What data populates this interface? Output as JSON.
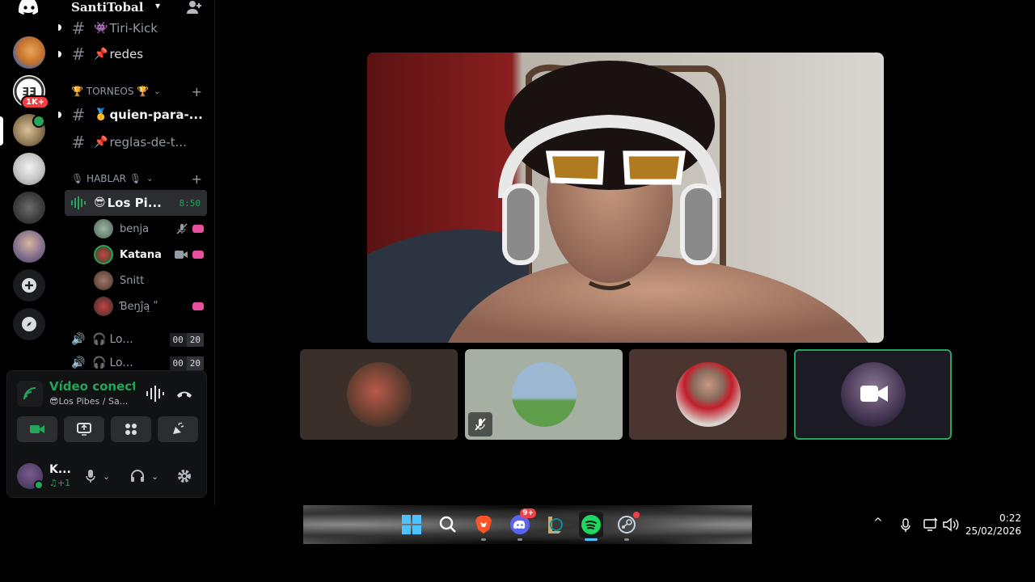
{
  "server": {
    "name": "SantiTobal",
    "chevron": "chevron-down-icon",
    "add_member_icon": "add-member-icon"
  },
  "rail": {
    "logo": "discord-icon",
    "mention_badge": "1K+",
    "add_server_icon": "plus-icon",
    "explore_icon": "compass-icon"
  },
  "channels": {
    "partial_top": "Tiri-Kick",
    "redes": {
      "emoji": "📌",
      "label": "redes"
    },
    "cat_torneos": "🏆 TORNEOS 🏆",
    "quien": {
      "emoji": "🥇",
      "label": "quien-para-..."
    },
    "reglas": {
      "emoji": "📌",
      "label": "reglas-de-t..."
    },
    "cat_hablar": "🎙 HABLAR 🎙",
    "voice_active": {
      "emoji": "😎",
      "label": "Los Pi...",
      "timer": "8:50"
    },
    "members": [
      {
        "name": "benja"
      },
      {
        "name": "Katana"
      },
      {
        "name": "Snitt"
      },
      {
        "name": "Ɓеŋĵą ʺ"
      }
    ],
    "voice2": {
      "label": "Lo...",
      "count1": "00",
      "count2": "20"
    },
    "voice3": {
      "label": "Lo...",
      "count1": "00",
      "count2": "20"
    }
  },
  "voice_panel": {
    "title": "Vídeo conectado",
    "subtitle": "😎Los Pibes / Sa...",
    "user_name": "K...",
    "user_status": "♫+1"
  },
  "taskbar": {
    "time": "0:22",
    "date": "25/02/2026",
    "discord_badge": "9+"
  },
  "colors": {
    "green": "#23a55a",
    "panel_bg": "#111214",
    "button_bg": "#2b2d31",
    "pink_badge": "#e84d9e"
  }
}
